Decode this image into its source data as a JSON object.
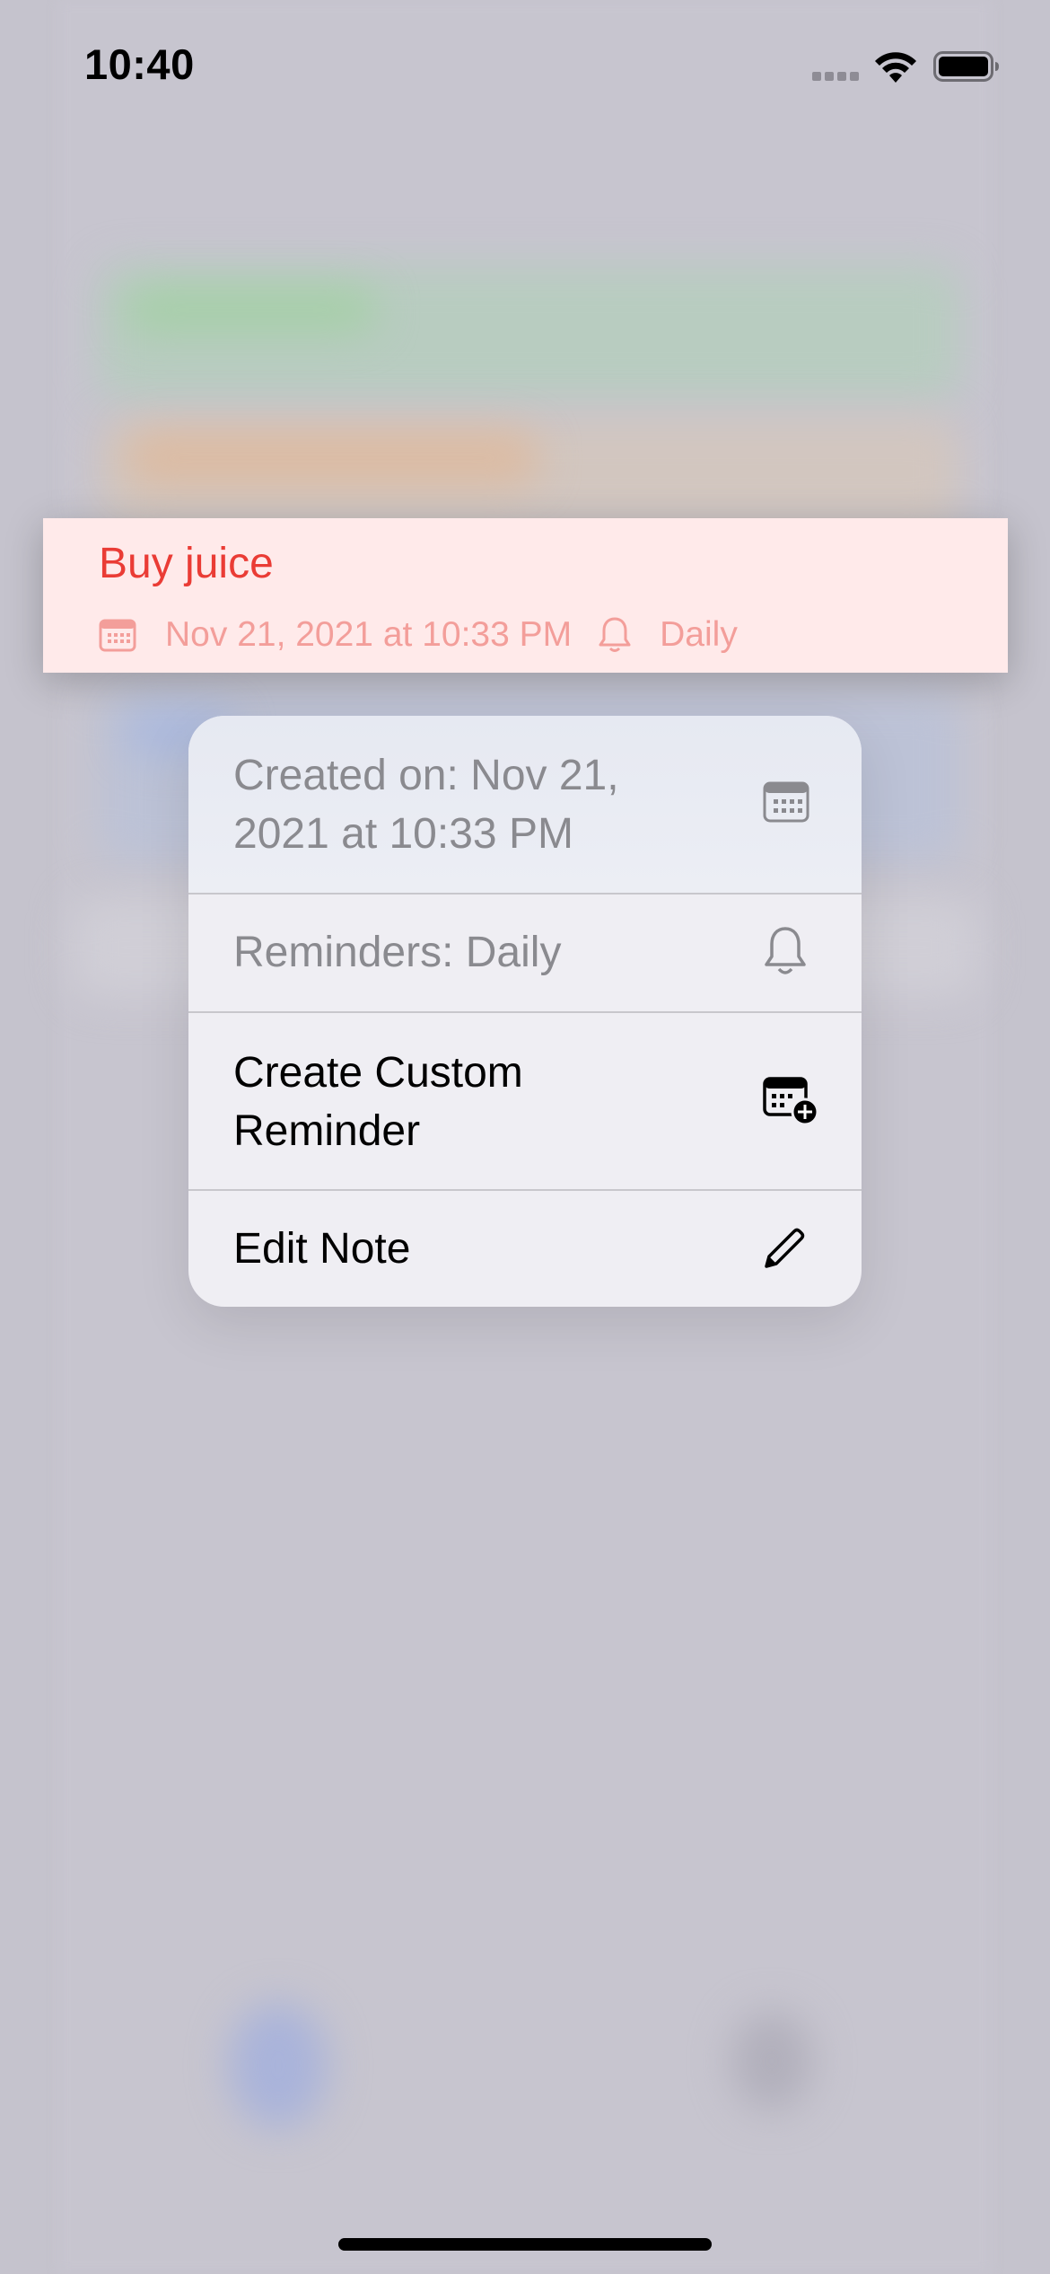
{
  "status_bar": {
    "time": "10:40"
  },
  "note": {
    "title": "Buy juice",
    "date": "Nov 21, 2021 at 10:33 PM",
    "repeat": "Daily",
    "title_color": "#ea3c35",
    "meta_color": "#f39e9a",
    "background": "#ffeaea"
  },
  "context_menu": {
    "items": [
      {
        "label": "Created on: Nov 21, 2021 at 10:33 PM",
        "icon": "calendar-icon",
        "enabled": false
      },
      {
        "label": "Reminders: Daily",
        "icon": "bell-icon",
        "enabled": false
      },
      {
        "label": "Create Custom Reminder",
        "icon": "calendar-plus-icon",
        "enabled": true
      },
      {
        "label": "Edit Note",
        "icon": "pencil-icon",
        "enabled": true
      }
    ]
  }
}
